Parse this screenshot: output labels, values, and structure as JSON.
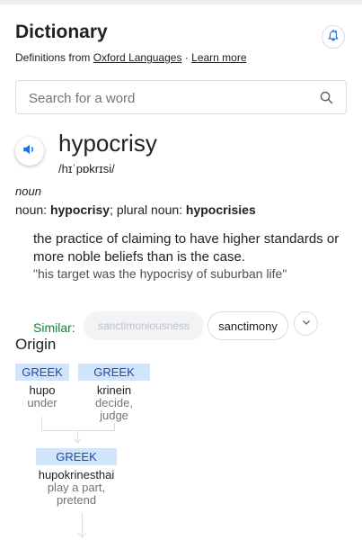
{
  "header": {
    "title": "Dictionary",
    "subtitle_prefix": "Definitions from",
    "source_link": "Oxford Languages",
    "separator": "·",
    "learn_more": "Learn more"
  },
  "search": {
    "placeholder": "Search for a word",
    "value": ""
  },
  "entry": {
    "word": "hypocrisy",
    "phonetic": "/hɪˈpɒkrɪsi/",
    "part_of_speech": "noun",
    "forms_label": "noun",
    "singular": "hypocrisy",
    "plural_label": "plural noun",
    "plural": "hypocrisies",
    "definition": "the practice of claiming to have higher standards or more noble beliefs than is the case.",
    "example": "\"his target was the hypocrisy of suburban life\"",
    "similar_label": "Similar:",
    "similar": [
      "sanctimoniousness",
      "sanctimony"
    ]
  },
  "origin": {
    "title": "Origin",
    "roots": [
      {
        "lang": "GREEK",
        "word": "hupo",
        "meaning": "under"
      },
      {
        "lang": "GREEK",
        "word": "krinein",
        "meaning": "decide, judge"
      }
    ],
    "combined": {
      "lang": "GREEK",
      "word": "hupokrinesthai",
      "meaning": "play a part, pretend"
    }
  },
  "colors": {
    "accent": "#1a73e8",
    "similar_green": "#188038",
    "origin_tag_bg": "#d2e3fc"
  },
  "icons": [
    "bell-plus-icon",
    "search-icon",
    "speaker-icon",
    "chevron-down-icon"
  ]
}
